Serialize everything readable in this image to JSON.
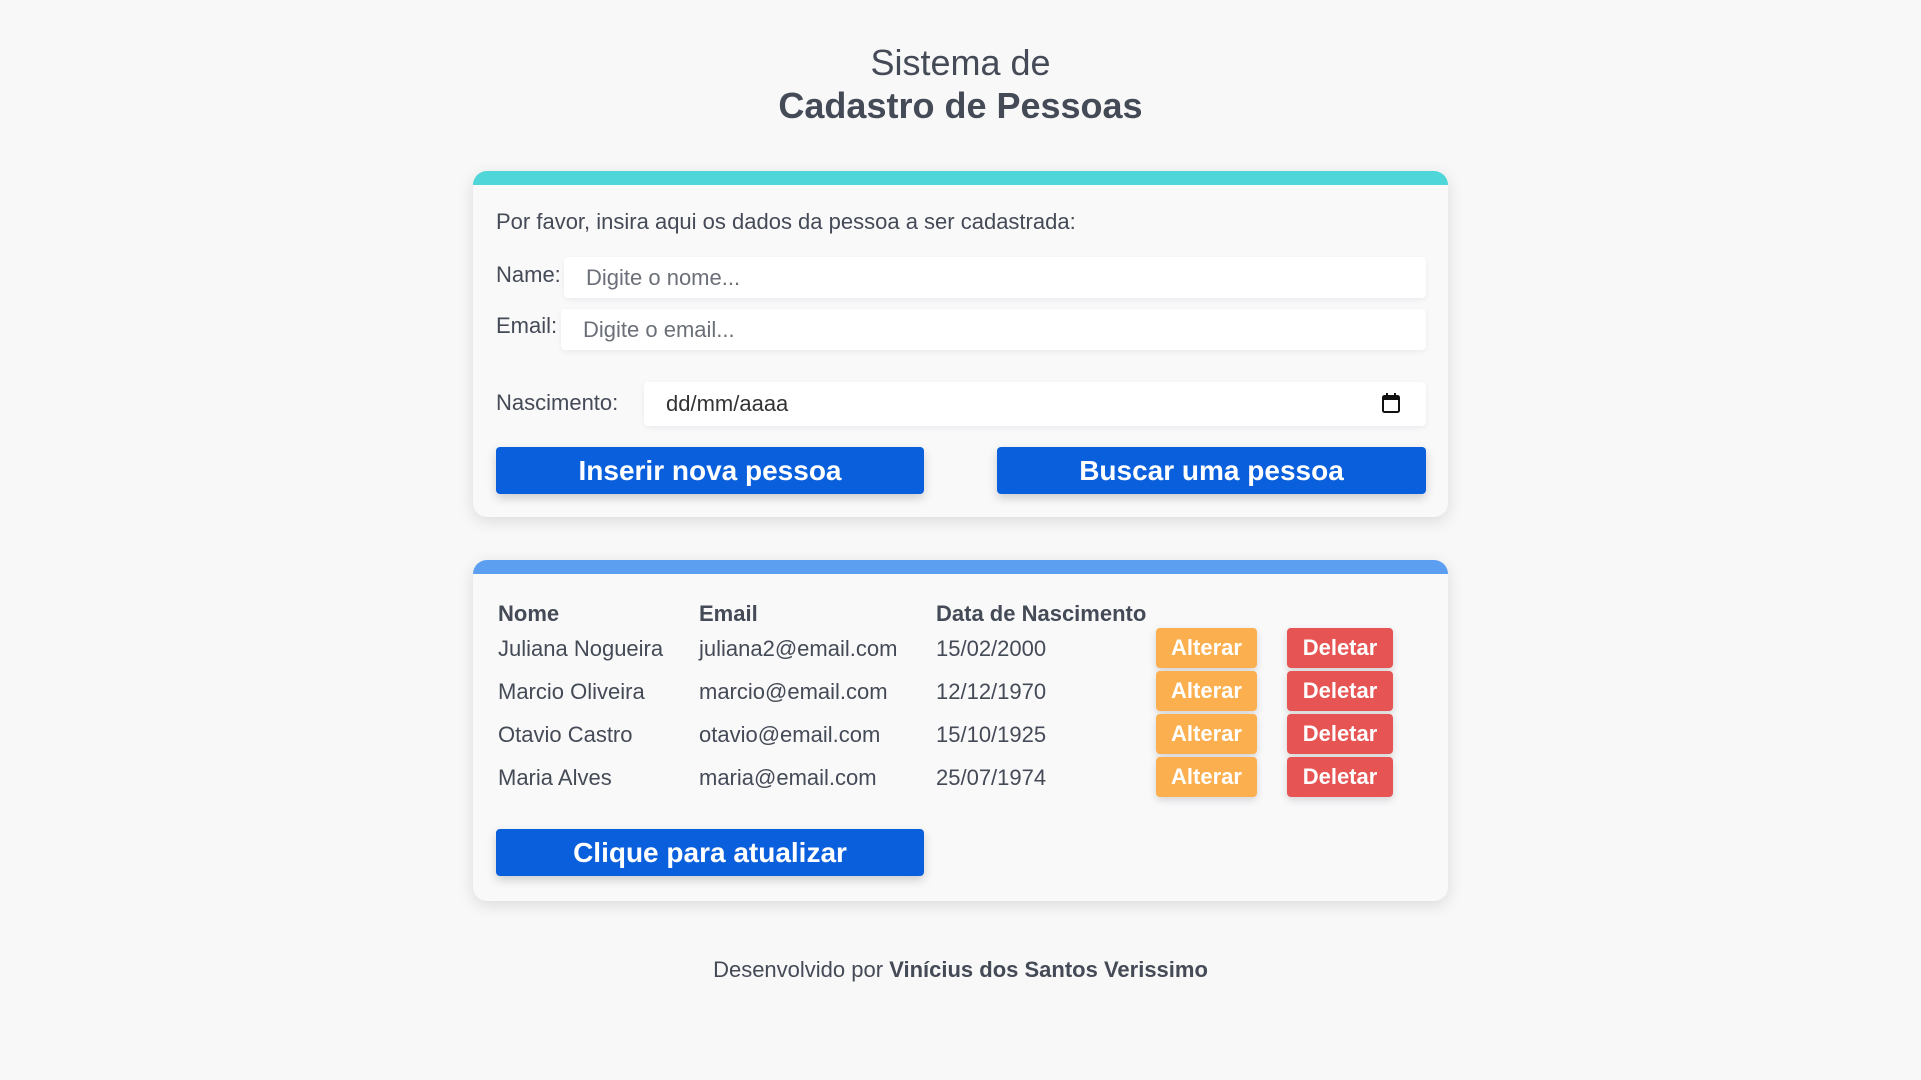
{
  "header": {
    "title_line1": "Sistema de",
    "title_line2": "Cadastro de Pessoas"
  },
  "form": {
    "intro": "Por favor, insira aqui os dados da pessoa a ser cadastrada:",
    "name_label": "Name:",
    "name_placeholder": "Digite o nome...",
    "name_value": "",
    "email_label": "Email:",
    "email_placeholder": "Digite o email...",
    "email_value": "",
    "birth_label": "Nascimento:",
    "birth_placeholder": "dd/mm/aaaa",
    "birth_icon": "calendar-icon",
    "insert_button": "Inserir nova pessoa",
    "search_button": "Buscar uma pessoa"
  },
  "list": {
    "columns": [
      "Nome",
      "Email",
      "Data de Nascimento"
    ],
    "rows": [
      {
        "name": "Juliana Nogueira",
        "email": "juliana2@email.com",
        "birth": "15/02/2000",
        "alter": "Alterar",
        "delete": "Deletar"
      },
      {
        "name": "Marcio Oliveira",
        "email": "marcio@email.com",
        "birth": "12/12/1970",
        "alter": "Alterar",
        "delete": "Deletar"
      },
      {
        "name": "Otavio Castro",
        "email": "otavio@email.com",
        "birth": "15/10/1925",
        "alter": "Alterar",
        "delete": "Deletar"
      },
      {
        "name": "Maria Alves",
        "email": "maria@email.com",
        "birth": "25/07/1974",
        "alter": "Alterar",
        "delete": "Deletar"
      }
    ],
    "refresh_button": "Clique para atualizar"
  },
  "footer": {
    "prefix": "Desenvolvido por",
    "author": "Vinícius dos Santos Verissimo"
  },
  "colors": {
    "background": "#f8f8f9",
    "form_accent": "#4fd6d8",
    "list_accent": "#5c9ff0",
    "primary_button": "#0a5fdd",
    "alter_button": "#fbaf4e",
    "delete_button": "#e65454",
    "text": "#444a56"
  }
}
